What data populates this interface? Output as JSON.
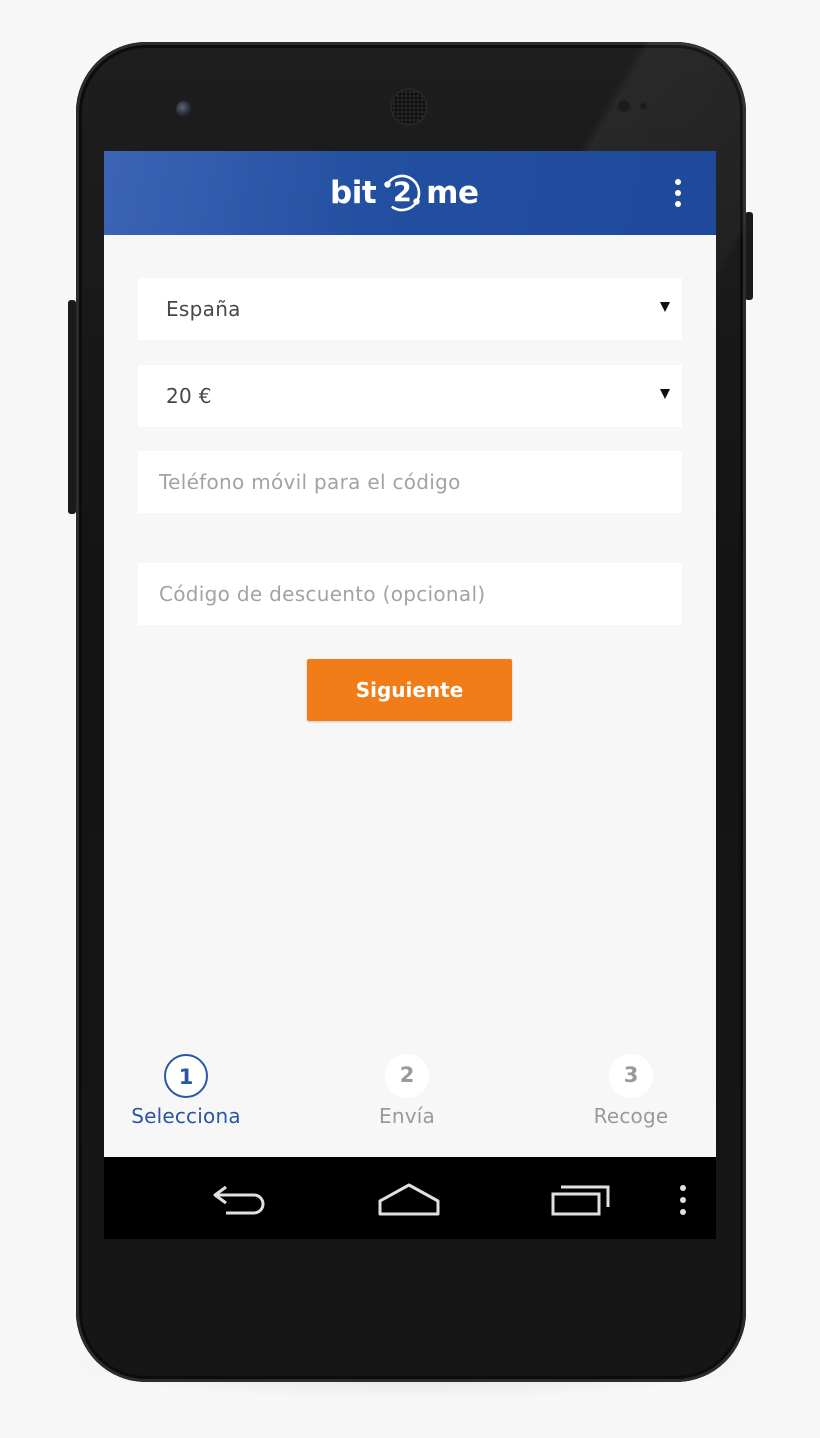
{
  "app": {
    "brand": {
      "prefix": "bit",
      "digit": "2",
      "suffix": "me"
    },
    "colors": {
      "app_bar": "#234fa0",
      "accent_button": "#f07d17",
      "active_step": "#2a56a4",
      "inactive_step": "#9a9a9a"
    },
    "menu_icon": "more-vert-icon"
  },
  "form": {
    "country": {
      "value": "España"
    },
    "amount": {
      "value": "20 €"
    },
    "phone": {
      "placeholder": "Teléfono móvil para el código",
      "value": ""
    },
    "discount": {
      "placeholder": "Código de descuento (opcional)",
      "value": ""
    },
    "next_label": "Siguiente"
  },
  "steps": [
    {
      "number": "1",
      "label": "Selecciona",
      "state": "active"
    },
    {
      "number": "2",
      "label": "Envía",
      "state": "inactive"
    },
    {
      "number": "3",
      "label": "Recoge",
      "state": "inactive"
    }
  ],
  "system_nav": {
    "back_icon": "back-icon",
    "home_icon": "home-icon",
    "recents_icon": "recents-icon",
    "overflow_icon": "overflow-icon"
  }
}
